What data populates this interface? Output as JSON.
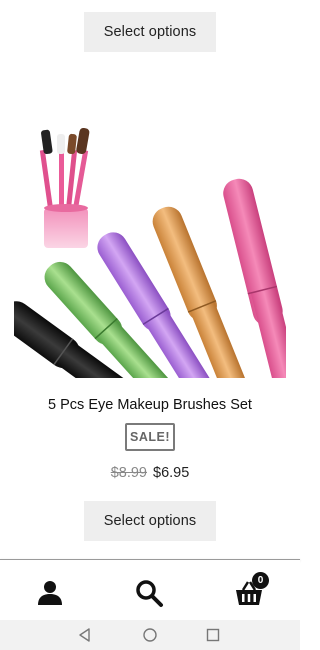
{
  "top_card": {
    "button_label": "Select options"
  },
  "product": {
    "title": "5 Pcs Eye Makeup Brushes Set",
    "badge": "SALE!",
    "price_old": "$8.99",
    "price_new": "$6.95",
    "button_label": "Select options"
  },
  "bottom_nav": {
    "items": [
      {
        "icon": "user-icon"
      },
      {
        "icon": "search-icon"
      },
      {
        "icon": "cart-icon",
        "count": "0"
      }
    ]
  },
  "system_nav": {
    "buttons": [
      "back-icon",
      "home-icon",
      "recents-icon"
    ]
  },
  "colors": {
    "button_bg": "#eeeeee",
    "brush_black": "#1a1a1a",
    "brush_green": "#7cc46a",
    "brush_purple": "#b67de0",
    "brush_gold": "#e4a25a",
    "brush_pink": "#ec6fa8"
  }
}
